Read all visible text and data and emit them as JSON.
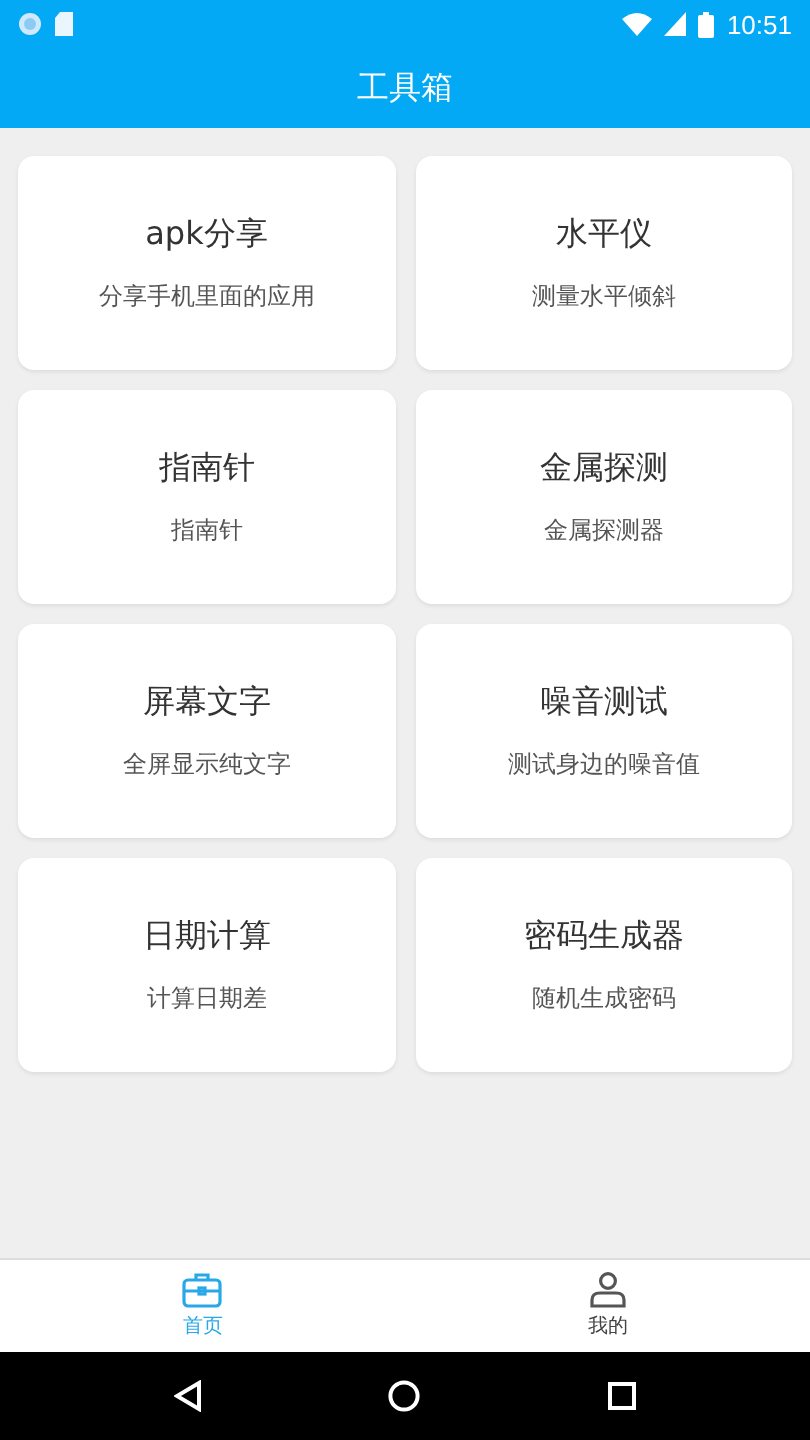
{
  "status_bar": {
    "time": "10:51"
  },
  "app_bar": {
    "title": "工具箱"
  },
  "tools": [
    {
      "title": "apk分享",
      "subtitle": "分享手机里面的应用"
    },
    {
      "title": "水平仪",
      "subtitle": "测量水平倾斜"
    },
    {
      "title": "指南针",
      "subtitle": "指南针"
    },
    {
      "title": "金属探测",
      "subtitle": "金属探测器"
    },
    {
      "title": "屏幕文字",
      "subtitle": "全屏显示纯文字"
    },
    {
      "title": "噪音测试",
      "subtitle": "测试身边的噪音值"
    },
    {
      "title": "日期计算",
      "subtitle": "计算日期差"
    },
    {
      "title": "密码生成器",
      "subtitle": "随机生成密码"
    }
  ],
  "bottom_nav": [
    {
      "label": "首页",
      "kind": "home",
      "selected": true
    },
    {
      "label": "我的",
      "kind": "profile",
      "selected": false
    }
  ]
}
